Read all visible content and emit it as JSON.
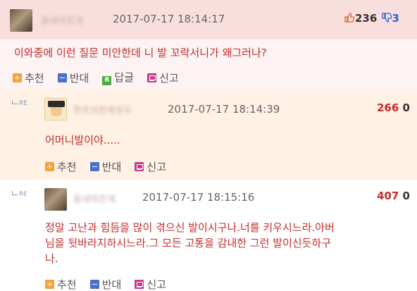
{
  "comments": [
    {
      "nickname": "동네의친개",
      "time": "2017-07-17 18:14:17",
      "up": "236",
      "down": "3",
      "text": "이와중에 이런 질문 미안한데 니 발 꼬락서니가 왜그러나?",
      "actions": [
        "추천",
        "반대",
        "답글",
        "신고"
      ],
      "reply_icon_letter": "R"
    },
    {
      "re_label": "RE",
      "nickname": "한조의완복유두",
      "time": "2017-07-17 18:14:39",
      "up": "266",
      "down": "0",
      "text": "어머니발이야.....",
      "actions": [
        "추천",
        "반대",
        "신고"
      ]
    },
    {
      "re_label": "RE",
      "nickname": "동네의친개",
      "time": "2017-07-17 18:15:16",
      "up": "407",
      "down": "0",
      "text_lines": [
        "정말 고난과 힘듬을 많이 겪으신 발이시구나.너를 키우시느라.아버",
        "님을 뒷바라지하시느라.그 모든 고통을 감내한 그런 발이신듯하구",
        "나."
      ],
      "actions": [
        "추천",
        "반대",
        "신고"
      ]
    }
  ],
  "colors": {
    "text_red": "#c42c2c",
    "down_blue": "#2d62c9",
    "header_pink": "#f9dede",
    "reply_bg": "#fff1e4"
  },
  "icons": {
    "thumb_up": "thumbs-up-icon",
    "thumb_down": "thumbs-down-icon",
    "recommend": "plus-icon",
    "oppose": "minus-icon",
    "reply": "r-letter-icon",
    "report": "report-icon"
  }
}
